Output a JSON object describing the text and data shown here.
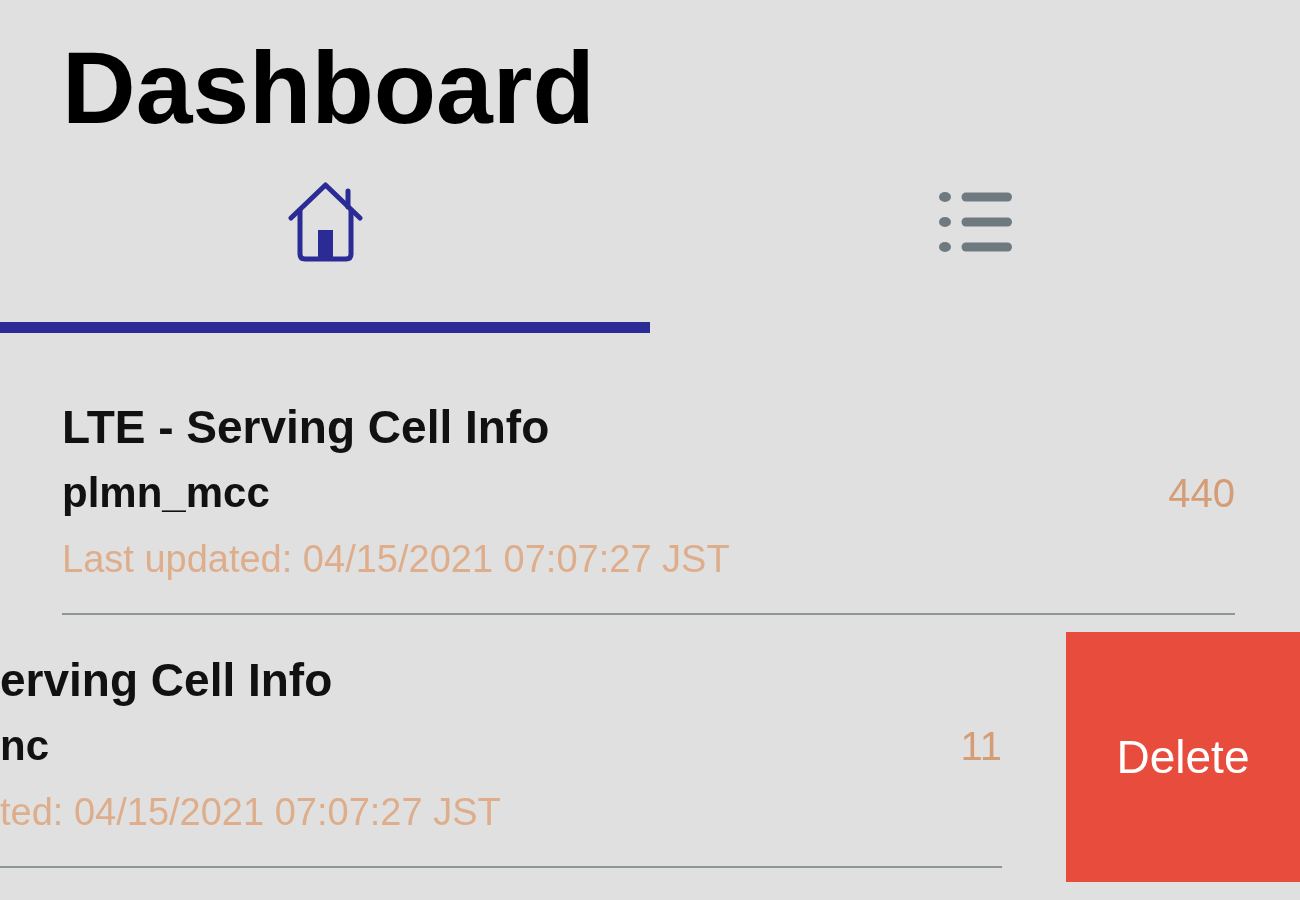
{
  "title": "Dashboard",
  "tabs": [
    {
      "kind": "home",
      "selected": true
    },
    {
      "kind": "list",
      "selected": false
    }
  ],
  "rows": [
    {
      "title": "LTE - Serving Cell Info",
      "field": "plmn_mcc",
      "value": "440",
      "updated": "Last updated: 04/15/2021 07:07:27 JST",
      "swiped": false
    },
    {
      "title": "erving Cell Info",
      "field": "nc",
      "value": "11",
      "updated": "ted: 04/15/2021 07:07:27 JST",
      "swiped": true,
      "action": "Delete"
    }
  ]
}
